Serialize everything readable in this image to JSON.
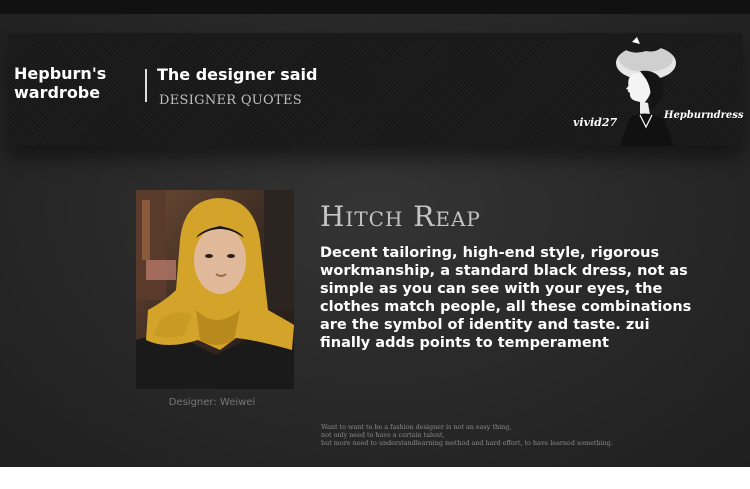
{
  "header": {
    "brand": "Hepburn's wardrobe",
    "section_title": "The designer said",
    "section_subtitle": "DESIGNER QUOTES",
    "signature_left": "vivid27",
    "signature_right": "Hepburndress"
  },
  "main": {
    "photo_caption": "Designer: Weiwei",
    "quote_title": "Hitch Reap",
    "quote_body": "Decent tailoring, high-end style, rigorous workmanship, a standard black dress, not as simple as you can see with your eyes, the clothes match people, all these combinations are the symbol of identity and taste. zui finally adds points to temperament",
    "fine_print": [
      "Want to want to be a fashion designer is not an easy thing,",
      "not only need to have a certain talent,",
      "but more need to understandlearning method and hard effort, to have learned something."
    ]
  },
  "colors": {
    "background": "#2a2a2a",
    "banner": "#1b1b1b",
    "scarf": "#d4a42a"
  },
  "icons": {
    "silhouette": "woman-silhouette-illustration",
    "portrait": "designer-portrait-photo"
  }
}
